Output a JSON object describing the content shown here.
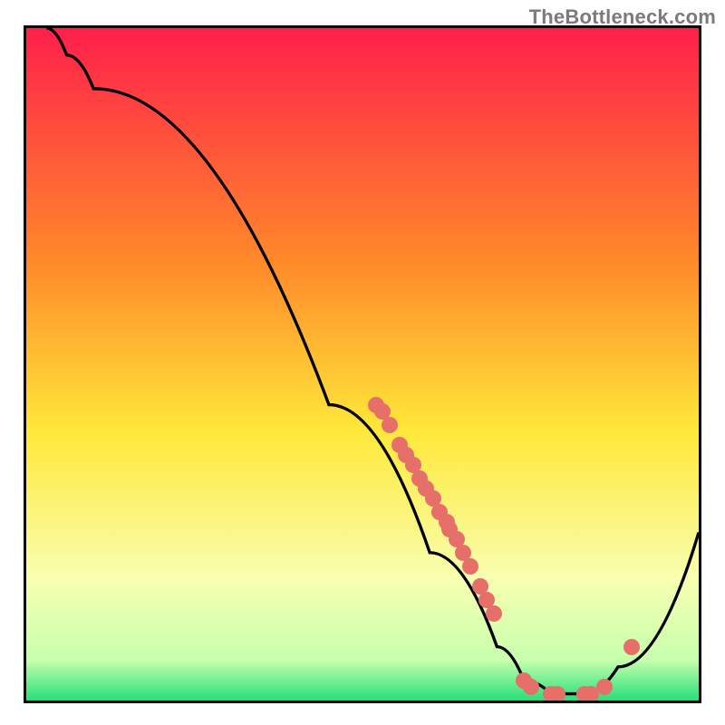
{
  "watermark": "TheBottleneck.com",
  "chart_data": {
    "type": "line",
    "title": "",
    "xlabel": "",
    "ylabel": "",
    "xlim": [
      0,
      100
    ],
    "ylim": [
      0,
      100
    ],
    "gradient_stops": [
      {
        "offset": 0,
        "color": "#ff1f4b"
      },
      {
        "offset": 35,
        "color": "#ff8a2a"
      },
      {
        "offset": 60,
        "color": "#ffe83a"
      },
      {
        "offset": 82,
        "color": "#f8ffb0"
      },
      {
        "offset": 94,
        "color": "#c6ffad"
      },
      {
        "offset": 100,
        "color": "#25e07a"
      }
    ],
    "curve": [
      {
        "x": 3,
        "y": 100
      },
      {
        "x": 6,
        "y": 96
      },
      {
        "x": 10,
        "y": 91
      },
      {
        "x": 45,
        "y": 44
      },
      {
        "x": 60,
        "y": 22
      },
      {
        "x": 70,
        "y": 8
      },
      {
        "x": 74,
        "y": 3
      },
      {
        "x": 78,
        "y": 1
      },
      {
        "x": 83,
        "y": 1
      },
      {
        "x": 88,
        "y": 5
      },
      {
        "x": 100,
        "y": 25
      }
    ],
    "scatter": [
      {
        "x": 52,
        "y": 44
      },
      {
        "x": 53,
        "y": 43
      },
      {
        "x": 54,
        "y": 41
      },
      {
        "x": 55.5,
        "y": 38
      },
      {
        "x": 56.5,
        "y": 36.5
      },
      {
        "x": 57.5,
        "y": 35
      },
      {
        "x": 58.5,
        "y": 33
      },
      {
        "x": 59.5,
        "y": 31.5
      },
      {
        "x": 60.5,
        "y": 30
      },
      {
        "x": 61.5,
        "y": 28
      },
      {
        "x": 62.5,
        "y": 26.5
      },
      {
        "x": 63,
        "y": 25.5
      },
      {
        "x": 64,
        "y": 24
      },
      {
        "x": 65,
        "y": 22
      },
      {
        "x": 66,
        "y": 20
      },
      {
        "x": 67.5,
        "y": 17
      },
      {
        "x": 68.5,
        "y": 15
      },
      {
        "x": 69.5,
        "y": 13
      },
      {
        "x": 74,
        "y": 3
      },
      {
        "x": 75,
        "y": 2
      },
      {
        "x": 78,
        "y": 1
      },
      {
        "x": 79,
        "y": 1
      },
      {
        "x": 83,
        "y": 1
      },
      {
        "x": 84,
        "y": 1
      },
      {
        "x": 86,
        "y": 2
      },
      {
        "x": 90,
        "y": 8
      }
    ],
    "dot_color": "#e76f6a",
    "curve_color": "#000000"
  }
}
